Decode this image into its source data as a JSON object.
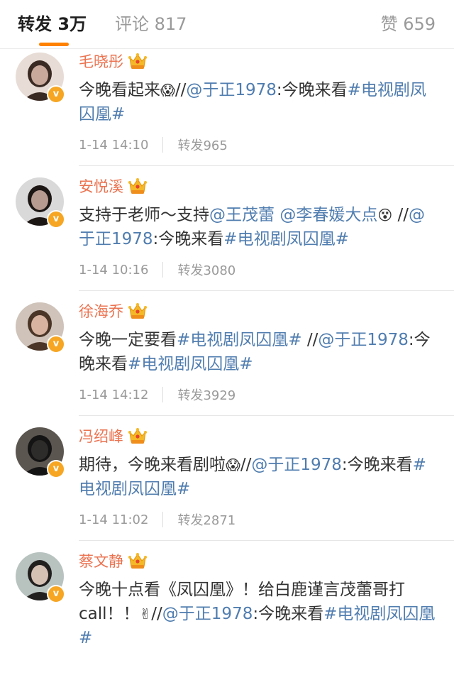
{
  "tabs": {
    "repost": "转发 3万",
    "comment": "评论 817",
    "like": "赞 659",
    "accent_color": "#ff8200"
  },
  "colors": {
    "name": "#eb7350",
    "link": "#507daf",
    "text": "#333333",
    "meta": "#9a9a9a",
    "vip_badge": "#f6a623"
  },
  "reposts": [
    {
      "name": "毛晓彤",
      "content": [
        {
          "t": "今晚看起来"
        },
        {
          "t": "😱",
          "type": "emoji"
        },
        {
          "t": "//"
        },
        {
          "t": "@于正1978",
          "type": "link"
        },
        {
          "t": ":今晚来看"
        },
        {
          "t": "#电视剧凤囚凰#",
          "type": "link"
        }
      ],
      "date": "1-14 14:10",
      "repost_count": "转发965"
    },
    {
      "name": "安悦溪",
      "content": [
        {
          "t": "支持于老师～支持"
        },
        {
          "t": "@王茂蕾",
          "type": "link"
        },
        {
          "t": " "
        },
        {
          "t": "@李春媛大点",
          "type": "link"
        },
        {
          "t": "😵",
          "type": "emoji"
        },
        {
          "t": " //"
        },
        {
          "t": "@于正1978",
          "type": "link"
        },
        {
          "t": ":今晚来看"
        },
        {
          "t": "#电视剧凤囚凰#",
          "type": "link"
        }
      ],
      "date": "1-14 10:16",
      "repost_count": "转发3080"
    },
    {
      "name": "徐海乔",
      "content": [
        {
          "t": "今晚一定要看"
        },
        {
          "t": "#电视剧凤囚凰#",
          "type": "link"
        },
        {
          "t": " //"
        },
        {
          "t": "@于正1978",
          "type": "link"
        },
        {
          "t": ":今晚来看"
        },
        {
          "t": "#电视剧凤囚凰#",
          "type": "link"
        }
      ],
      "date": "1-14 14:12",
      "repost_count": "转发3929"
    },
    {
      "name": "冯绍峰",
      "content": [
        {
          "t": "期待，今晚来看剧啦"
        },
        {
          "t": "😱",
          "type": "emoji"
        },
        {
          "t": "//"
        },
        {
          "t": "@于正1978",
          "type": "link"
        },
        {
          "t": ":今晚来看"
        },
        {
          "t": "#电视剧凤囚凰#",
          "type": "link"
        }
      ],
      "date": "1-14 11:02",
      "repost_count": "转发2871"
    },
    {
      "name": "蔡文静",
      "content": [
        {
          "t": "今晚十点看《凤囚凰》！给白鹿谨言茂蕾哥打call！！"
        },
        {
          "t": "✌",
          "type": "emoji"
        },
        {
          "t": "//"
        },
        {
          "t": "@于正1978",
          "type": "link"
        },
        {
          "t": ":今晚来看"
        },
        {
          "t": "#电视剧凤囚凰#",
          "type": "link"
        }
      ],
      "date": "",
      "repost_count": ""
    }
  ]
}
